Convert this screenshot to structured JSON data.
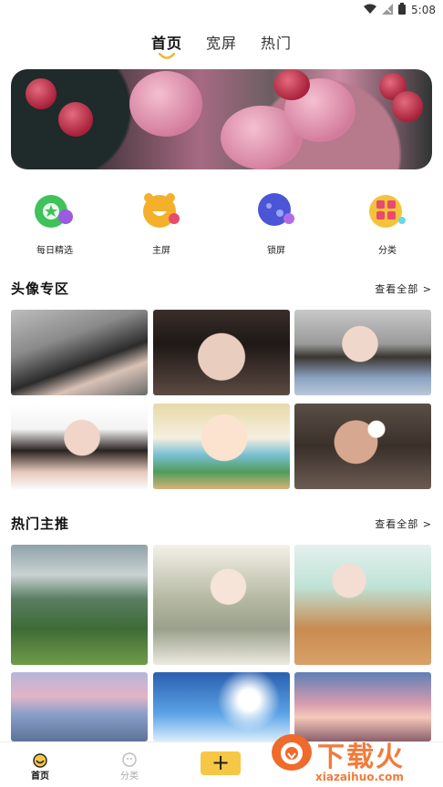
{
  "status": {
    "time": "5:08"
  },
  "nav": {
    "tabs": [
      "首页",
      "宽屏",
      "热门"
    ],
    "active_tab": "首页"
  },
  "quick_links": [
    {
      "label": "每日精选",
      "icon": "daily-pick-icon",
      "color": "#3ec25a"
    },
    {
      "label": "主屏",
      "icon": "home-screen-icon",
      "color": "#f4b02b"
    },
    {
      "label": "锁屏",
      "icon": "lock-screen-icon",
      "color": "#4a56d6"
    },
    {
      "label": "分类",
      "icon": "category-icon",
      "color": "#f3c33a"
    }
  ],
  "sections": {
    "avatars": {
      "title": "头像专区",
      "more": "查看全部 >"
    },
    "hot": {
      "title": "热门主推",
      "more": "查看全部 >"
    }
  },
  "bottom_nav": {
    "home": "首页",
    "category": "分类",
    "add": "+"
  },
  "watermark": {
    "title": "下载火",
    "url": "xiazaihuo.com"
  },
  "colors": {
    "accent": "#f6c744",
    "active_tab_underline": "#f2b72f"
  }
}
